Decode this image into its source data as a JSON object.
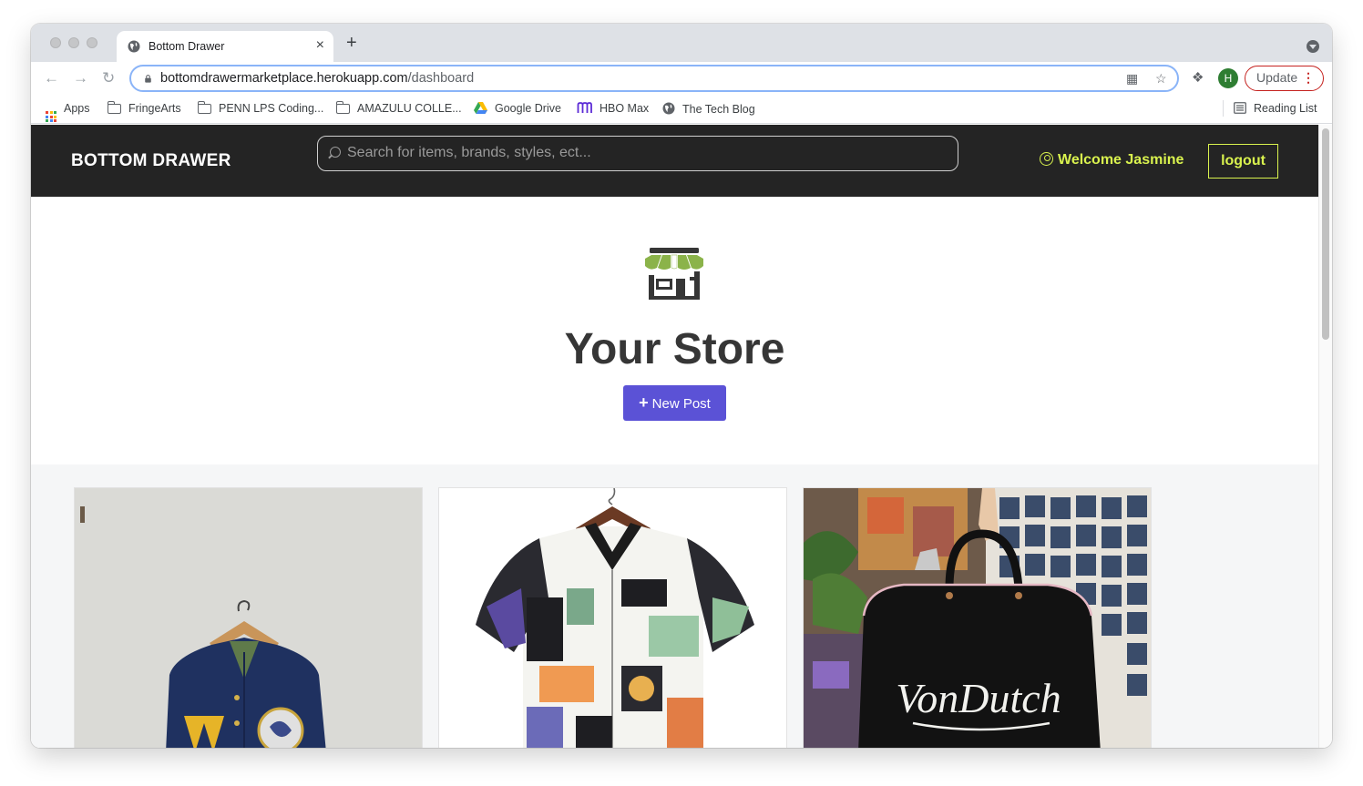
{
  "browser": {
    "tab_title": "Bottom Drawer",
    "tab_close": "×",
    "new_tab": "+",
    "url_host": "bottomdrawermarketplace.herokuapp.com",
    "url_path": "/dashboard",
    "profile_initial": "H",
    "update_label": "Update",
    "bookmarks": [
      {
        "label": "Apps",
        "icon": "apps-grid-icon"
      },
      {
        "label": "FringeArts",
        "icon": "folder-icon"
      },
      {
        "label": "PENN LPS Coding...",
        "icon": "folder-icon"
      },
      {
        "label": "AMAZULU COLLE...",
        "icon": "folder-icon"
      },
      {
        "label": "Google Drive",
        "icon": "google-drive-icon"
      },
      {
        "label": "HBO Max",
        "icon": "hbo-max-icon"
      },
      {
        "label": "The Tech Blog",
        "icon": "globe-icon"
      }
    ],
    "reading_list": "Reading List"
  },
  "site": {
    "brand": "BOTTOM DRAWER",
    "search_placeholder": "Search for items, brands, styles, ect...",
    "welcome": "Welcome Jasmine",
    "logout": "logout",
    "page_title": "Your Store",
    "new_post": "New Post",
    "products": [
      {
        "name": "varsity jacket"
      },
      {
        "name": "patterned shirt"
      },
      {
        "name": "Von Dutch bag",
        "logo_text": "VonDutch"
      }
    ]
  },
  "colors": {
    "header_bg": "#242424",
    "accent_yellow": "#d9f24e",
    "button_purple": "#5b52d6",
    "title_text": "#363636"
  }
}
